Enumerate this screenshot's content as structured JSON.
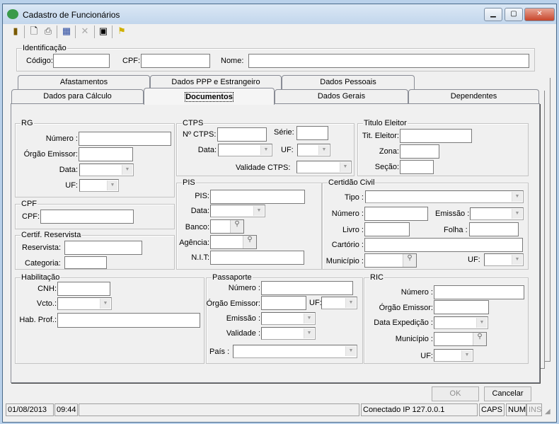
{
  "window": {
    "title": "Cadastro de Funcionários",
    "minimize": "▁",
    "maximize": "▢",
    "close": "✕"
  },
  "toolbar": {
    "exit": "exit-icon",
    "new": "new-document-icon",
    "print": "printer-icon",
    "search": "grid-search-icon",
    "delete": "delete-icon",
    "save": "save-icon",
    "extra": "flag-icon"
  },
  "identificacao": {
    "title": "Identificação",
    "codigo": "Código:",
    "cpf": "CPF:",
    "nome": "Nome:"
  },
  "tabs": {
    "back": [
      "Afastamentos",
      "Dados PPP e Estrangeiro",
      "Dados Pessoais"
    ],
    "front": [
      "Dados para Cálculo",
      "Documentos",
      "Dados Gerais",
      "Dependentes"
    ],
    "selected": "Documentos"
  },
  "rg": {
    "title": "RG",
    "numero": "Número :",
    "orgao": "Órgão Emissor:",
    "data": "Data:",
    "uf": "UF:"
  },
  "cpf": {
    "title": "CPF",
    "cpf": "CPF:"
  },
  "reservista": {
    "title": "Certif. Reservista",
    "reservista": "Reservista:",
    "categoria": "Categoria:"
  },
  "habilitacao": {
    "title": "Habilitação",
    "cnh": "CNH:",
    "vcto": "Vcto.:",
    "habprof": "Hab. Prof.:"
  },
  "ctps": {
    "title": "CTPS",
    "numero": "Nº CTPS:",
    "serie": "Série:",
    "data": "Data:",
    "uf": "UF:",
    "validade": "Validade CTPS:"
  },
  "pis": {
    "title": "PIS",
    "pis": "PIS:",
    "data": "Data:",
    "banco": "Banco:",
    "agencia": "Agência:",
    "nit": "N.I.T:"
  },
  "titulo": {
    "title": "Titulo Eleitor",
    "tit": "Tit. Eleitor:",
    "zona": "Zona:",
    "secao": "Seção:"
  },
  "certidao": {
    "title": "Certidão Civil",
    "tipo": "Tipo :",
    "numero": "Número :",
    "emissao": "Emissão :",
    "livro": "Livro :",
    "folha": "Folha :",
    "cartorio": "Cartório :",
    "municipio": "Município :",
    "uf": "UF:"
  },
  "passaporte": {
    "title": "Passaporte",
    "numero": "Número :",
    "orgao": "Órgão Emissor:",
    "uf": "UF:",
    "emissao": "Emissão :",
    "validade": "Validade :",
    "pais": "País :"
  },
  "ric": {
    "title": "RIC",
    "numero": "Número :",
    "orgao": "Órgão Emissor:",
    "data": "Data Expedição :",
    "municipio": "Município :",
    "uf": "UF:"
  },
  "buttons": {
    "ok": "OK",
    "cancel": "Cancelar"
  },
  "status": {
    "date": "01/08/2013",
    "time": "09:44",
    "connection": "Conectado IP 127.0.0.1",
    "caps": "CAPS",
    "num": "NUM",
    "ins": "INS"
  }
}
